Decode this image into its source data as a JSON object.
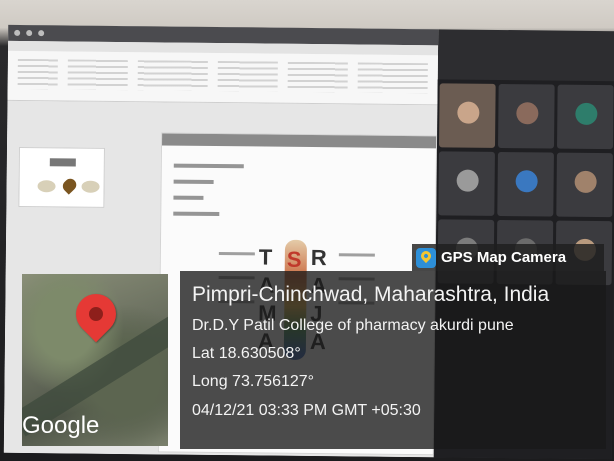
{
  "gps_overlay": {
    "app_name": "GPS Map Camera",
    "location_title": "Pimpri-Chinchwad, Maharashtra, India",
    "place": "Dr.D.Y Patil College of pharmacy akurdi pune",
    "latitude": "Lat 18.630508°",
    "longitude": "Long 73.756127°",
    "timestamp": "04/12/21 03:33 PM GMT +05:30"
  },
  "map": {
    "provider_logo": "Google",
    "pin_icon": "map-pin-icon",
    "pin_color": "#e53935"
  },
  "slide": {
    "letters_left": [
      "T",
      "A",
      "M",
      "A"
    ],
    "letters_middle": [
      "S"
    ],
    "letters_right": [
      "R",
      "A",
      "J",
      "A"
    ]
  },
  "participants": [
    {
      "avatar_color": "#c9a58a"
    },
    {
      "avatar_color": "#8a6a5c"
    },
    {
      "avatar_color": "#2e7d6b"
    },
    {
      "avatar_color": "#9a9a9a"
    },
    {
      "avatar_color": "#3a78c0"
    },
    {
      "avatar_color": "#a0826b"
    },
    {
      "avatar_color": "#7c7c7c"
    },
    {
      "avatar_color": "#6b6b6b"
    },
    {
      "avatar_color": "#b99a7e"
    }
  ]
}
